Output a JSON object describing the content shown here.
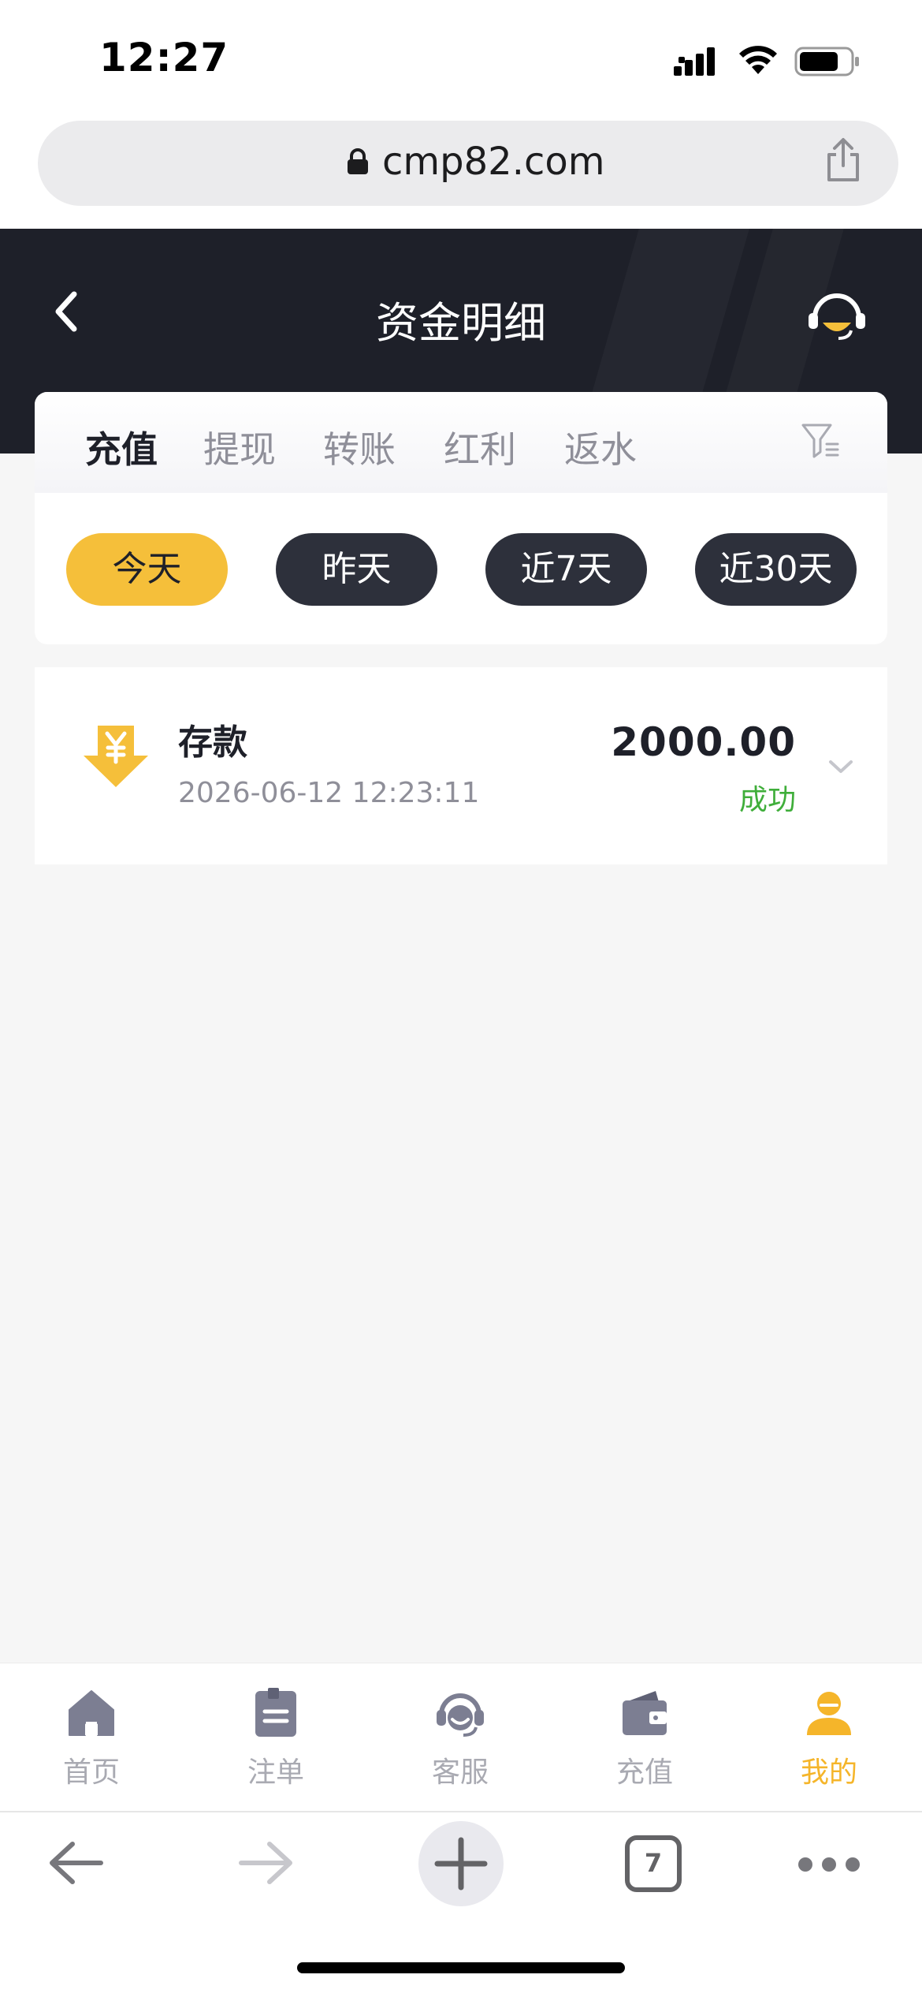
{
  "status_bar": {
    "time": "12:27"
  },
  "browser": {
    "url": "cmp82.com",
    "tab_count": "7"
  },
  "header": {
    "title": "资金明细"
  },
  "tabs": [
    {
      "label": "充值",
      "active": true
    },
    {
      "label": "提现",
      "active": false
    },
    {
      "label": "转账",
      "active": false
    },
    {
      "label": "红利",
      "active": false
    },
    {
      "label": "返水",
      "active": false
    }
  ],
  "date_filters": [
    {
      "label": "今天",
      "active": true
    },
    {
      "label": "昨天",
      "active": false
    },
    {
      "label": "近7天",
      "active": false
    },
    {
      "label": "近30天",
      "active": false
    }
  ],
  "records": [
    {
      "title": "存款",
      "time": "2026-06-12 12:23:11",
      "amount": "2000.00",
      "status": "成功",
      "icon": "yuan-down-arrow-icon"
    }
  ],
  "bottom_nav": [
    {
      "label": "首页",
      "icon": "home-icon",
      "active": false
    },
    {
      "label": "注单",
      "icon": "bet-slip-icon",
      "active": false
    },
    {
      "label": "客服",
      "icon": "customer-service-icon",
      "active": false
    },
    {
      "label": "充值",
      "icon": "wallet-icon",
      "active": false
    },
    {
      "label": "我的",
      "icon": "profile-icon",
      "active": true
    }
  ],
  "colors": {
    "accent": "#f5bf3a",
    "header_bg": "#1e2029",
    "pill_bg": "#2d303b",
    "success": "#3fae3a"
  }
}
